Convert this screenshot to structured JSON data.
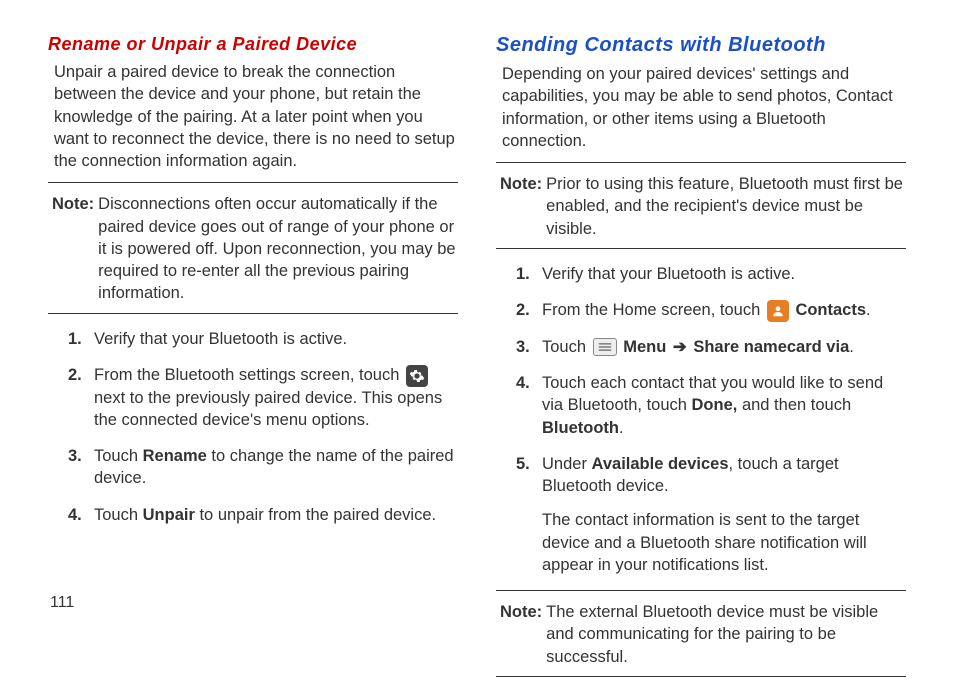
{
  "pageNumber": "111",
  "left": {
    "heading": "Rename or Unpair a Paired Device",
    "intro": "Unpair a paired device to break the connection between the device and your phone, but retain the knowledge of the pairing. At a later point when you want to reconnect the device, there is no need to setup the connection information again.",
    "noteLabel": "Note:",
    "noteBody": "Disconnections often occur automatically if the paired device goes out of range of your phone or it is powered off. Upon reconnection, you may be required to re-enter all the previous pairing information.",
    "steps": {
      "s1num": "1.",
      "s1": "Verify that your Bluetooth is active.",
      "s2num": "2.",
      "s2a": "From the Bluetooth settings screen, touch ",
      "s2b": " next to the previously paired device. This opens the connected device's menu options.",
      "s3num": "3.",
      "s3a": "Touch ",
      "s3bold": "Rename",
      "s3b": " to change the name of the paired device.",
      "s4num": "4.",
      "s4a": "Touch ",
      "s4bold": "Unpair",
      "s4b": " to unpair from the paired device."
    }
  },
  "right": {
    "heading": "Sending Contacts with Bluetooth",
    "intro": "Depending on your paired devices' settings and capabilities, you may be able to send photos, Contact information, or other items using a Bluetooth connection.",
    "note1Label": "Note:",
    "note1Body": "Prior to using this feature, Bluetooth must first be enabled, and the recipient's device must be visible.",
    "steps": {
      "s1num": "1.",
      "s1": "Verify that your Bluetooth is active.",
      "s2num": "2.",
      "s2a": "From the Home screen, touch ",
      "s2bold": "Contacts",
      "s2b": ".",
      "s3num": "3.",
      "s3a": "Touch ",
      "s3bold1": "Menu",
      "s3arrow": "➔",
      "s3bold2": "Share namecard via",
      "s3b": ".",
      "s4num": "4.",
      "s4a": "Touch each contact that you would like to send via Bluetooth, touch ",
      "s4bold1": "Done,",
      "s4b": " and then touch ",
      "s4bold2": "Bluetooth",
      "s4c": ".",
      "s5num": "5.",
      "s5a": "Under ",
      "s5bold": "Available devices",
      "s5b": ", touch a target Bluetooth device.",
      "s5sub": "The contact information is sent to the target device and a Bluetooth share notification will appear in your notifications list."
    },
    "note2Label": "Note:",
    "note2Body": "The external Bluetooth device must be visible and communicating for the pairing to be successful."
  }
}
